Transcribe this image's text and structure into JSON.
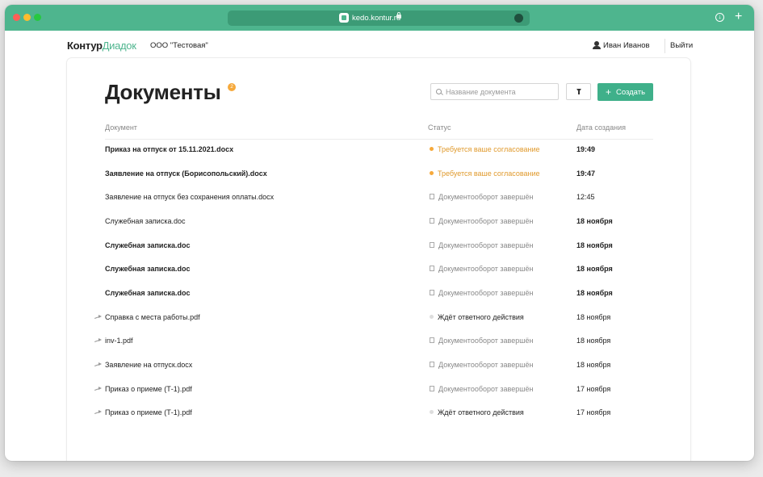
{
  "browser": {
    "url": "kedo.kontur.ru"
  },
  "header": {
    "logo_kontur": "Контур",
    "logo_diadoc": "Диадок",
    "org": "ООО \"Тестовая\"",
    "user": "Иван Иванов",
    "logout": "Выйти"
  },
  "page": {
    "title": "Документы",
    "badge": "2",
    "search_placeholder": "Название документа",
    "create_label": "Создать"
  },
  "table": {
    "columns": [
      "Документ",
      "Статус",
      "Дата создания"
    ],
    "rows": [
      {
        "name": "Приказ на отпуск от 15.11.2021.docx",
        "status": "Требуется ваше согласование",
        "date": "19:49"
      },
      {
        "name": "Заявление на отпуск (Борисопольский).docx",
        "status": "Требуется ваше согласование",
        "date": "19:47"
      },
      {
        "name": "Заявление на отпуск без сохранения оплаты.docx",
        "status": "Документооборот завершён",
        "date": "12:45"
      },
      {
        "name": "Служебная записка.doc",
        "status": "Документооборот завершён",
        "date": "18 ноября"
      },
      {
        "name": "Служебная записка.doc",
        "status": "Документооборот завершён",
        "date": "18 ноября"
      },
      {
        "name": "Служебная записка.doc",
        "status": "Документооборот завершён",
        "date": "18 ноября"
      },
      {
        "name": "Служебная записка.doc",
        "status": "Документооборот завершён",
        "date": "18 ноября"
      },
      {
        "name": "Справка с места работы.pdf",
        "status": "Ждёт ответного действия",
        "date": "18 ноября"
      },
      {
        "name": "inv-1.pdf",
        "status": "Документооборот завершён",
        "date": "18 ноября"
      },
      {
        "name": "Заявление на отпуск.docx",
        "status": "Документооборот завершён",
        "date": "18 ноября"
      },
      {
        "name": "Приказ о приеме (Т-1).pdf",
        "status": "Документооборот завершён",
        "date": "17 ноября"
      },
      {
        "name": "Приказ о приеме (Т-1).pdf",
        "status": "Ждёт ответного действия",
        "date": "17 ноября"
      }
    ]
  }
}
